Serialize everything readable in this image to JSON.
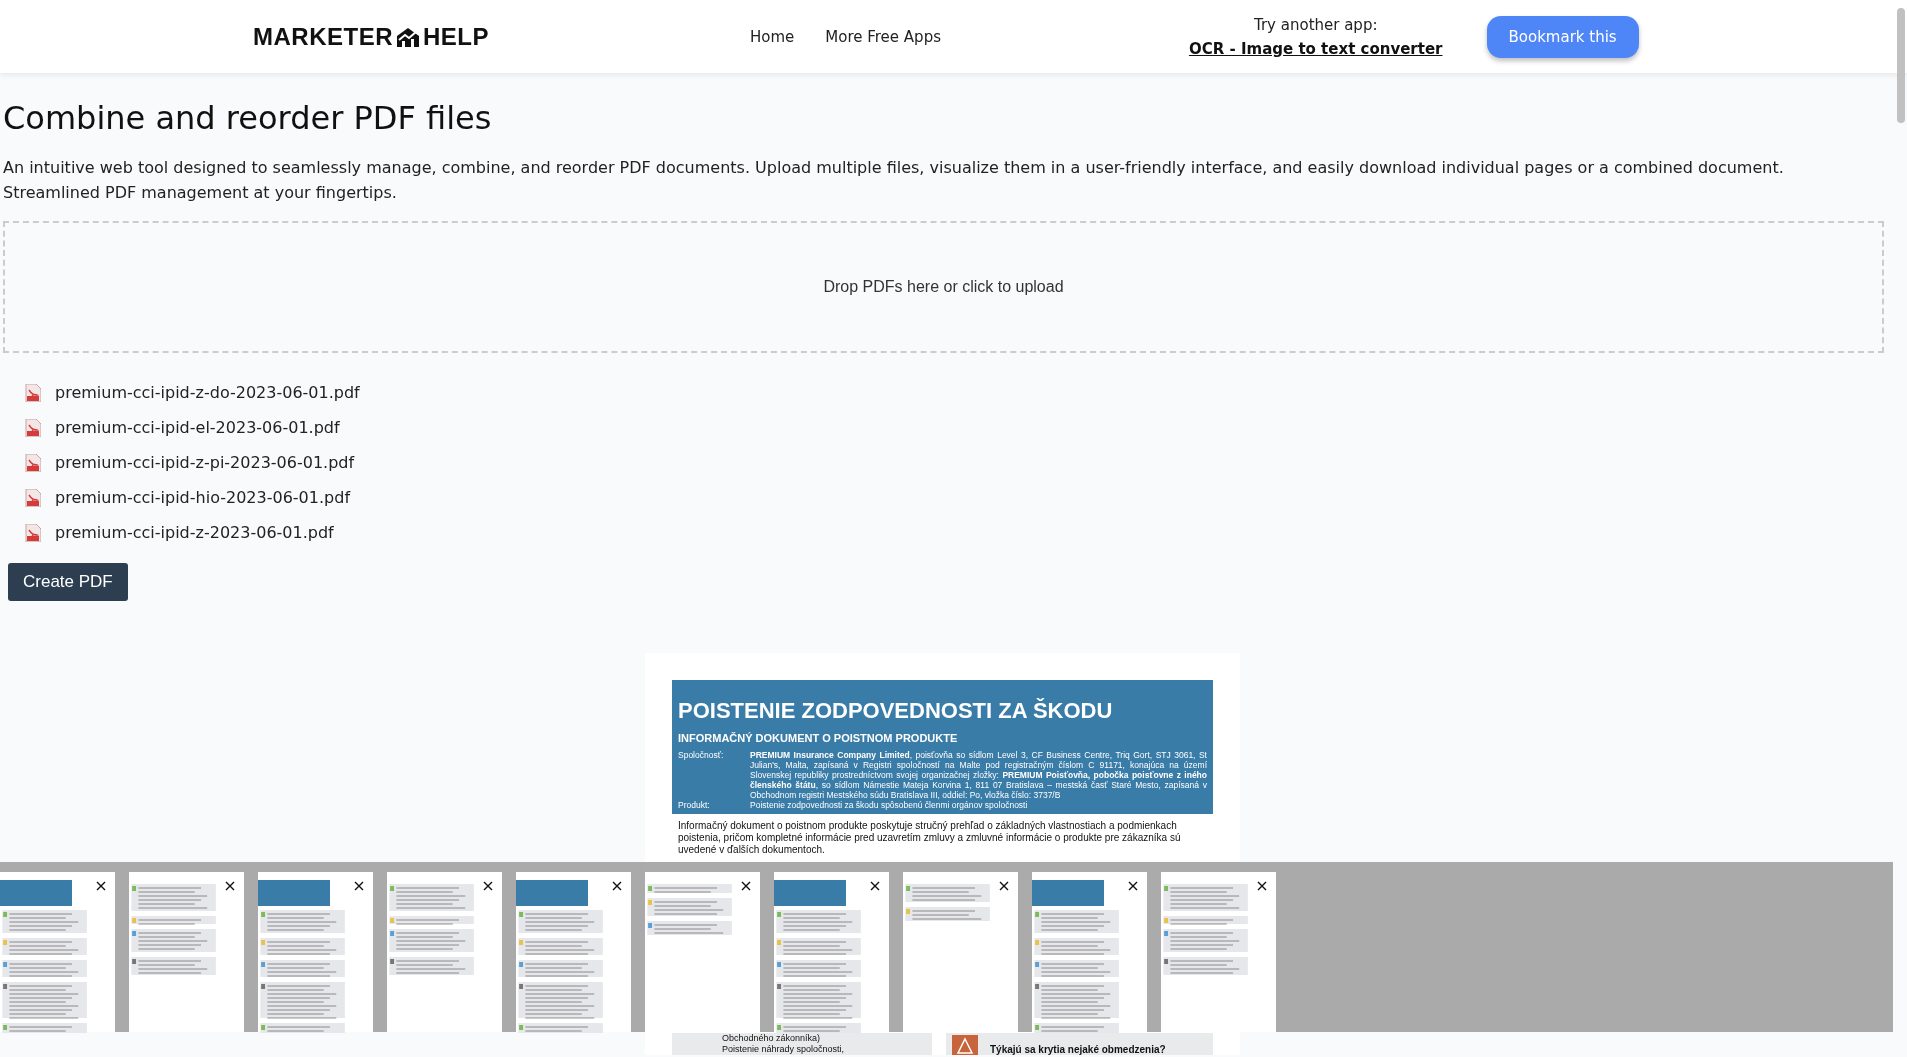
{
  "header": {
    "logo_left": "MARKETER",
    "logo_right": "HELP",
    "nav": [
      "Home",
      "More Free Apps"
    ],
    "promo_label": "Try another app:",
    "promo_link": "OCR - Image to text converter",
    "bookmark_button": "Bookmark this"
  },
  "title": "Combine and reorder PDF files",
  "description": "An intuitive web tool designed to seamlessly manage, combine, and reorder PDF documents. Upload multiple files, visualize them in a user-friendly interface, and easily download individual pages or a combined document. Streamlined PDF management at your fingertips.",
  "dropzone": {
    "text": "Drop PDFs here or click to upload"
  },
  "files": [
    "premium-cci-ipid-z-do-2023-06-01.pdf",
    "premium-cci-ipid-el-2023-06-01.pdf",
    "premium-cci-ipid-z-pi-2023-06-01.pdf",
    "premium-cci-ipid-hio-2023-06-01.pdf",
    "premium-cci-ipid-z-2023-06-01.pdf"
  ],
  "create_button": "Create PDF",
  "preview": {
    "title": "POISTENIE ZODPOVEDNOSTI ZA ŠKODU",
    "subtitle": "INFORMAČNÝ DOKUMENT O POISTNOM PRODUKTE",
    "rows": [
      {
        "label": "Spoločnosť:",
        "value": "**PREMIUM Insurance Company Limited**, poisťovňa so sídlom Level 3, CF Business Centre, Triq Gort, STJ 3061, St Julian's, Malta, zapísaná v Registri spoločností na Malte pod registračným číslom C 91171, konajúca na území Slovenskej republiky prostredníctvom svojej organizačnej zložky: **PREMIUM Poisťovňa, pobočka poisťovne z iného členského štátu**, so sídlom Námestie Mateja Korvina 1, 811 07 Bratislava – mestská časť Staré Mesto, zapísaná v Obchodnom registri Mestského súdu Bratislava III, oddiel: Po, vložka číslo: 3737/B"
      },
      {
        "label": "Produkt:",
        "value": "Poistenie zodpovednosti za škodu spôsobenú členmi orgánov spoločnosti"
      }
    ],
    "intro": "Informačný dokument o poistnom produkte poskytuje stručný prehľad o základných vlastnostiach a podmienkach poistenia, pričom kompletné informácie pred uzavretím zmluvy a zmluvné informácie o produkte pre zákazníka sú uvedené v ďalších dokumentoch.",
    "left_lines": [
      "Obchodného zákonníka)",
      "Poistenie náhrady spoločnosti,"
    ],
    "right_heading": "Týkajú sa krytia nejaké obmedzenia?"
  },
  "thumbnails": [
    {
      "kind": "cover"
    },
    {
      "kind": "text"
    },
    {
      "kind": "cover"
    },
    {
      "kind": "text"
    },
    {
      "kind": "cover"
    },
    {
      "kind": "partial"
    },
    {
      "kind": "cover"
    },
    {
      "kind": "short"
    },
    {
      "kind": "cover"
    },
    {
      "kind": "text"
    }
  ]
}
